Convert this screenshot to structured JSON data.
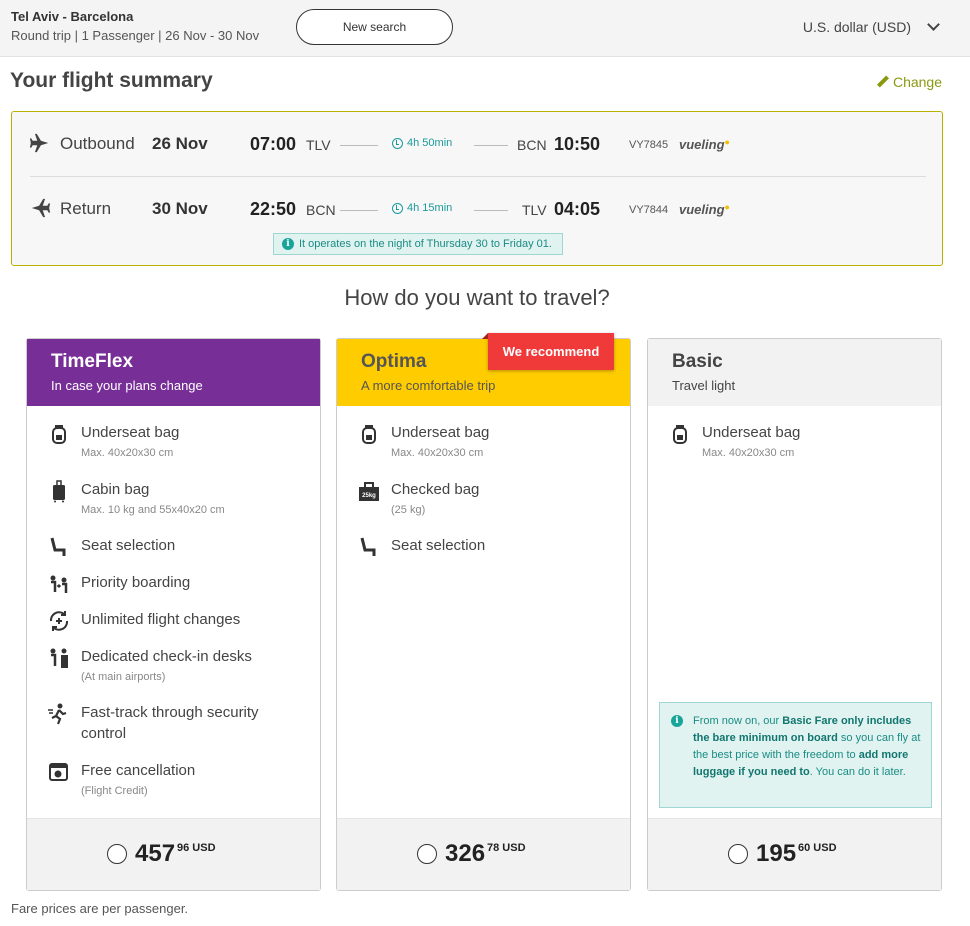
{
  "header": {
    "route": "Tel Aviv - Barcelona",
    "trip_info": "Round trip | 1 Passenger | 26 Nov - 30 Nov",
    "new_search_label": "New search",
    "currency": "U.S. dollar (USD)"
  },
  "summary": {
    "title": "Your flight summary",
    "change_label": "Change",
    "outbound": {
      "label": "Outbound",
      "date": "26 Nov",
      "dep_time": "07:00",
      "dep_code": "TLV",
      "duration": "4h 50min",
      "arr_code": "BCN",
      "arr_time": "10:50",
      "flight_no": "VY7845",
      "airline": "vueling"
    },
    "return": {
      "label": "Return",
      "date": "30 Nov",
      "dep_time": "22:50",
      "dep_code": "BCN",
      "duration": "4h 15min",
      "arr_code": "TLV",
      "arr_time": "04:05",
      "flight_no": "VY7844",
      "airline": "vueling"
    },
    "night_note": "It operates on the night of Thursday 30 to Friday 01."
  },
  "question": "How do you want to travel?",
  "fares": {
    "timeflex": {
      "name": "TimeFlex",
      "tagline": "In case your plans change",
      "features": [
        {
          "title": "Underseat bag",
          "sub": "Max. 40x20x30 cm"
        },
        {
          "title": "Cabin bag",
          "sub": "Max. 10 kg and 55x40x20 cm"
        },
        {
          "title": "Seat selection"
        },
        {
          "title": "Priority boarding"
        },
        {
          "title": "Unlimited flight changes"
        },
        {
          "title": "Dedicated check-in desks",
          "sub": "(At main airports)"
        },
        {
          "title": "Fast-track through security control"
        },
        {
          "title": "Free cancellation",
          "sub": "(Flight Credit)"
        }
      ],
      "price_int": "457",
      "price_dec": "96",
      "currency": "USD"
    },
    "optima": {
      "name": "Optima",
      "tagline": "A more comfortable trip",
      "badge": "We recommend",
      "features": [
        {
          "title": "Underseat bag",
          "sub": "Max. 40x20x30 cm"
        },
        {
          "title": "Checked bag",
          "sub": "(25 kg)"
        },
        {
          "title": "Seat selection"
        }
      ],
      "price_int": "326",
      "price_dec": "78",
      "currency": "USD"
    },
    "basic": {
      "name": "Basic",
      "tagline": "Travel light",
      "features": [
        {
          "title": "Underseat bag",
          "sub": "Max. 40x20x30 cm"
        }
      ],
      "info": {
        "p1": "From now on, our ",
        "b1": "Basic Fare only includes the bare minimum on board",
        "p2": " so you can fly at the best price with the freedom to ",
        "b2": "add more luggage if you need to",
        "p3": ". You can do it later."
      },
      "price_int": "195",
      "price_dec": "60",
      "currency": "USD"
    }
  },
  "footer_note": "Fare prices are per passenger.",
  "colors": {
    "timeflex": "#772e97",
    "optima": "#ffcc00",
    "basic": "#f2f2f2",
    "recommend": "#f03a3a",
    "accent_teal": "#19a49a",
    "change_green": "#8a9a10"
  }
}
